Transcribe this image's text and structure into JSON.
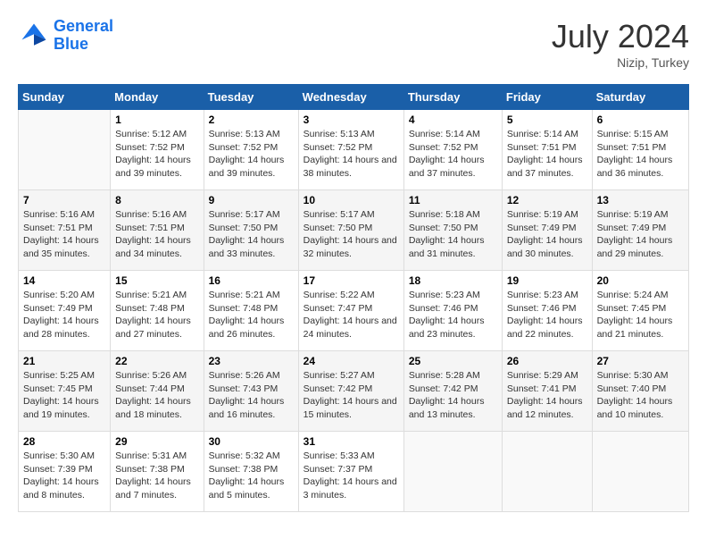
{
  "header": {
    "logo_line1": "General",
    "logo_line2": "Blue",
    "title": "July 2024",
    "location": "Nizip, Turkey"
  },
  "weekdays": [
    "Sunday",
    "Monday",
    "Tuesday",
    "Wednesday",
    "Thursday",
    "Friday",
    "Saturday"
  ],
  "weeks": [
    [
      {
        "day": "",
        "sunrise": "",
        "sunset": "",
        "daylight": ""
      },
      {
        "day": "1",
        "sunrise": "Sunrise: 5:12 AM",
        "sunset": "Sunset: 7:52 PM",
        "daylight": "Daylight: 14 hours and 39 minutes."
      },
      {
        "day": "2",
        "sunrise": "Sunrise: 5:13 AM",
        "sunset": "Sunset: 7:52 PM",
        "daylight": "Daylight: 14 hours and 39 minutes."
      },
      {
        "day": "3",
        "sunrise": "Sunrise: 5:13 AM",
        "sunset": "Sunset: 7:52 PM",
        "daylight": "Daylight: 14 hours and 38 minutes."
      },
      {
        "day": "4",
        "sunrise": "Sunrise: 5:14 AM",
        "sunset": "Sunset: 7:52 PM",
        "daylight": "Daylight: 14 hours and 37 minutes."
      },
      {
        "day": "5",
        "sunrise": "Sunrise: 5:14 AM",
        "sunset": "Sunset: 7:51 PM",
        "daylight": "Daylight: 14 hours and 37 minutes."
      },
      {
        "day": "6",
        "sunrise": "Sunrise: 5:15 AM",
        "sunset": "Sunset: 7:51 PM",
        "daylight": "Daylight: 14 hours and 36 minutes."
      }
    ],
    [
      {
        "day": "7",
        "sunrise": "Sunrise: 5:16 AM",
        "sunset": "Sunset: 7:51 PM",
        "daylight": "Daylight: 14 hours and 35 minutes."
      },
      {
        "day": "8",
        "sunrise": "Sunrise: 5:16 AM",
        "sunset": "Sunset: 7:51 PM",
        "daylight": "Daylight: 14 hours and 34 minutes."
      },
      {
        "day": "9",
        "sunrise": "Sunrise: 5:17 AM",
        "sunset": "Sunset: 7:50 PM",
        "daylight": "Daylight: 14 hours and 33 minutes."
      },
      {
        "day": "10",
        "sunrise": "Sunrise: 5:17 AM",
        "sunset": "Sunset: 7:50 PM",
        "daylight": "Daylight: 14 hours and 32 minutes."
      },
      {
        "day": "11",
        "sunrise": "Sunrise: 5:18 AM",
        "sunset": "Sunset: 7:50 PM",
        "daylight": "Daylight: 14 hours and 31 minutes."
      },
      {
        "day": "12",
        "sunrise": "Sunrise: 5:19 AM",
        "sunset": "Sunset: 7:49 PM",
        "daylight": "Daylight: 14 hours and 30 minutes."
      },
      {
        "day": "13",
        "sunrise": "Sunrise: 5:19 AM",
        "sunset": "Sunset: 7:49 PM",
        "daylight": "Daylight: 14 hours and 29 minutes."
      }
    ],
    [
      {
        "day": "14",
        "sunrise": "Sunrise: 5:20 AM",
        "sunset": "Sunset: 7:49 PM",
        "daylight": "Daylight: 14 hours and 28 minutes."
      },
      {
        "day": "15",
        "sunrise": "Sunrise: 5:21 AM",
        "sunset": "Sunset: 7:48 PM",
        "daylight": "Daylight: 14 hours and 27 minutes."
      },
      {
        "day": "16",
        "sunrise": "Sunrise: 5:21 AM",
        "sunset": "Sunset: 7:48 PM",
        "daylight": "Daylight: 14 hours and 26 minutes."
      },
      {
        "day": "17",
        "sunrise": "Sunrise: 5:22 AM",
        "sunset": "Sunset: 7:47 PM",
        "daylight": "Daylight: 14 hours and 24 minutes."
      },
      {
        "day": "18",
        "sunrise": "Sunrise: 5:23 AM",
        "sunset": "Sunset: 7:46 PM",
        "daylight": "Daylight: 14 hours and 23 minutes."
      },
      {
        "day": "19",
        "sunrise": "Sunrise: 5:23 AM",
        "sunset": "Sunset: 7:46 PM",
        "daylight": "Daylight: 14 hours and 22 minutes."
      },
      {
        "day": "20",
        "sunrise": "Sunrise: 5:24 AM",
        "sunset": "Sunset: 7:45 PM",
        "daylight": "Daylight: 14 hours and 21 minutes."
      }
    ],
    [
      {
        "day": "21",
        "sunrise": "Sunrise: 5:25 AM",
        "sunset": "Sunset: 7:45 PM",
        "daylight": "Daylight: 14 hours and 19 minutes."
      },
      {
        "day": "22",
        "sunrise": "Sunrise: 5:26 AM",
        "sunset": "Sunset: 7:44 PM",
        "daylight": "Daylight: 14 hours and 18 minutes."
      },
      {
        "day": "23",
        "sunrise": "Sunrise: 5:26 AM",
        "sunset": "Sunset: 7:43 PM",
        "daylight": "Daylight: 14 hours and 16 minutes."
      },
      {
        "day": "24",
        "sunrise": "Sunrise: 5:27 AM",
        "sunset": "Sunset: 7:42 PM",
        "daylight": "Daylight: 14 hours and 15 minutes."
      },
      {
        "day": "25",
        "sunrise": "Sunrise: 5:28 AM",
        "sunset": "Sunset: 7:42 PM",
        "daylight": "Daylight: 14 hours and 13 minutes."
      },
      {
        "day": "26",
        "sunrise": "Sunrise: 5:29 AM",
        "sunset": "Sunset: 7:41 PM",
        "daylight": "Daylight: 14 hours and 12 minutes."
      },
      {
        "day": "27",
        "sunrise": "Sunrise: 5:30 AM",
        "sunset": "Sunset: 7:40 PM",
        "daylight": "Daylight: 14 hours and 10 minutes."
      }
    ],
    [
      {
        "day": "28",
        "sunrise": "Sunrise: 5:30 AM",
        "sunset": "Sunset: 7:39 PM",
        "daylight": "Daylight: 14 hours and 8 minutes."
      },
      {
        "day": "29",
        "sunrise": "Sunrise: 5:31 AM",
        "sunset": "Sunset: 7:38 PM",
        "daylight": "Daylight: 14 hours and 7 minutes."
      },
      {
        "day": "30",
        "sunrise": "Sunrise: 5:32 AM",
        "sunset": "Sunset: 7:38 PM",
        "daylight": "Daylight: 14 hours and 5 minutes."
      },
      {
        "day": "31",
        "sunrise": "Sunrise: 5:33 AM",
        "sunset": "Sunset: 7:37 PM",
        "daylight": "Daylight: 14 hours and 3 minutes."
      },
      {
        "day": "",
        "sunrise": "",
        "sunset": "",
        "daylight": ""
      },
      {
        "day": "",
        "sunrise": "",
        "sunset": "",
        "daylight": ""
      },
      {
        "day": "",
        "sunrise": "",
        "sunset": "",
        "daylight": ""
      }
    ]
  ]
}
